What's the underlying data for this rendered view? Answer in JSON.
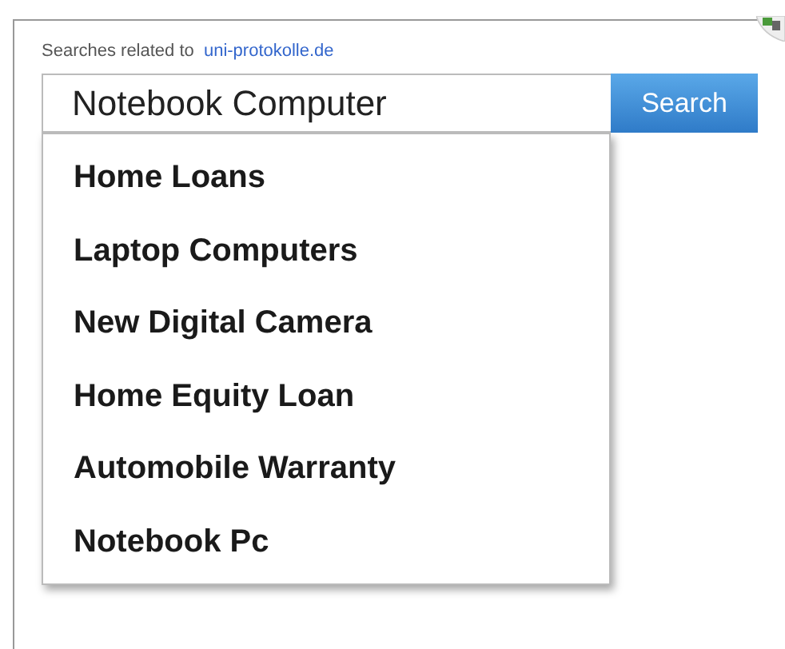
{
  "header": {
    "prefix": "Searches related to",
    "link": "uni-protokolle.de"
  },
  "search": {
    "value": "Notebook Computer",
    "button": "Search"
  },
  "suggestions": [
    {
      "label": "Home Loans"
    },
    {
      "label": "Laptop Computers"
    },
    {
      "label": "New Digital Camera"
    },
    {
      "label": "Home Equity Loan"
    },
    {
      "label": "Automobile Warranty"
    },
    {
      "label": "Notebook Pc"
    }
  ]
}
